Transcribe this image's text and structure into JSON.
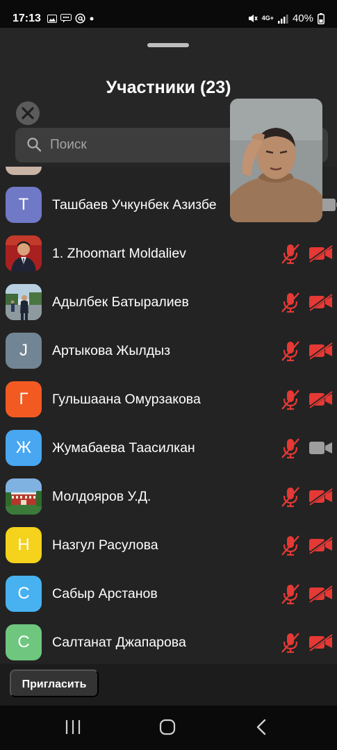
{
  "status_bar": {
    "time": "17:13",
    "network": "4G+",
    "battery": "40%"
  },
  "panel": {
    "title": "Участники (23)"
  },
  "search": {
    "placeholder": "Поиск"
  },
  "colors": {
    "muted_red": "#e53935",
    "camera_on_gray": "#9e9e9e"
  },
  "participants": [
    {
      "name": "Ташбаев Учкунбек Азизбе",
      "initial": "Т",
      "avatar_color": "#7079c6",
      "mic": "hidden",
      "camera": "on"
    },
    {
      "name": "1. Zhoomart Moldaliev",
      "initial": "",
      "avatar_color": "#8c1d1d",
      "mic": "muted",
      "camera": "off"
    },
    {
      "name": "Адылбек Батыралиев",
      "initial": "",
      "avatar_color": "#6f8aa8",
      "mic": "muted",
      "camera": "off"
    },
    {
      "name": "Артыкова Жылдыз",
      "initial": "J",
      "avatar_color": "#718594",
      "mic": "muted",
      "camera": "off"
    },
    {
      "name": "Гульшаана Омурзакова",
      "initial": "Г",
      "avatar_color": "#f25a22",
      "mic": "muted",
      "camera": "off"
    },
    {
      "name": "Жумабаева Таасилкан",
      "initial": "Ж",
      "avatar_color": "#48a7f0",
      "mic": "muted",
      "camera": "on"
    },
    {
      "name": "Молдояров У.Д.",
      "initial": "",
      "avatar_color": "#4d7bb0",
      "mic": "muted",
      "camera": "off"
    },
    {
      "name": "Назгул Расулова",
      "initial": "Н",
      "avatar_color": "#f5d21c",
      "mic": "muted",
      "camera": "off"
    },
    {
      "name": "Сабыр Арстанов",
      "initial": "С",
      "avatar_color": "#48b2f0",
      "mic": "muted",
      "camera": "off"
    },
    {
      "name": "Салтанат Джапарова",
      "initial": "С",
      "avatar_color": "#6fc77f",
      "mic": "muted",
      "camera": "off"
    }
  ],
  "footer": {
    "invite_label": "Пригласить"
  }
}
